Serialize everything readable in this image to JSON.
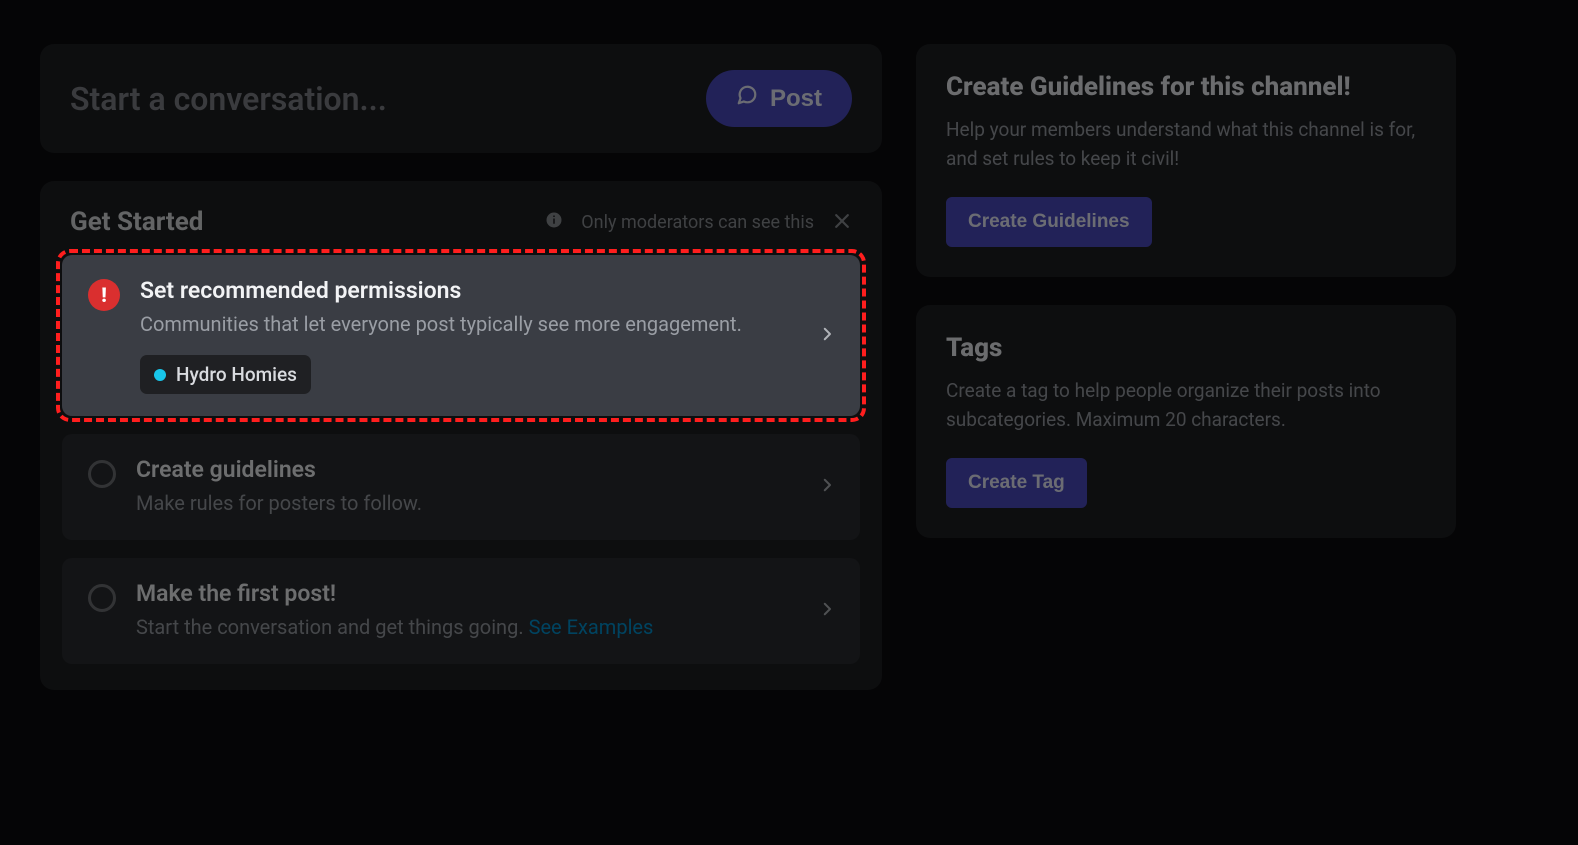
{
  "composer": {
    "placeholder": "Start a conversation...",
    "post_label": "Post"
  },
  "get_started": {
    "title": "Get Started",
    "moderator_note": "Only moderators can see this",
    "steps": [
      {
        "title": "Set recommended permissions",
        "desc": "Communities that let everyone post typically see more engagement.",
        "role": "Hydro Homies"
      },
      {
        "title": "Create guidelines",
        "desc": "Make rules for posters to follow."
      },
      {
        "title": "Make the first post!",
        "desc_prefix": "Start the conversation and get things going. ",
        "link": "See Examples"
      }
    ]
  },
  "guidelines_card": {
    "title": "Create Guidelines for this channel!",
    "desc": "Help your members understand what this channel is for, and set rules to keep it civil!",
    "button": "Create Guidelines"
  },
  "tags_card": {
    "title": "Tags",
    "desc": "Create a tag to help people organize their posts into subcategories. Maximum 20 characters.",
    "button": "Create Tag"
  }
}
